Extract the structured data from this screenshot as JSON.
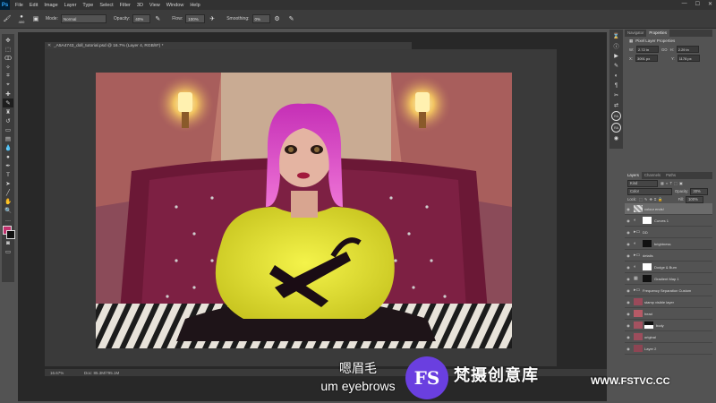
{
  "app": {
    "logo": "Ps"
  },
  "menu": [
    "File",
    "Edit",
    "Image",
    "Layer",
    "Type",
    "Select",
    "Filter",
    "3D",
    "View",
    "Window",
    "Help"
  ],
  "window_controls": [
    "—",
    "☐",
    "✕"
  ],
  "options": {
    "brush_size": "400",
    "mode_label": "Mode:",
    "mode_value": "Normal",
    "opacity_label": "Opacity:",
    "opacity_value": "40%",
    "flow_label": "Flow:",
    "flow_value": "100%",
    "smoothing_label": "Smoothing:",
    "smoothing_value": "0%"
  },
  "document": {
    "tab_title": "_A5A4743_doll_tutorial.psd @ 16.7% (Layer 4, RGB/8*) *",
    "zoom": "16.67%",
    "doc_size": "Doc: 85.3M/795.1M"
  },
  "properties": {
    "tabs": [
      "Navigator",
      "Properties"
    ],
    "title": "Pixel Layer Properties",
    "w_label": "W:",
    "w_value": "2.72 in",
    "go_label": "GO",
    "h_label": "H:",
    "h_value": "2.29 in",
    "x_label": "X:",
    "x_value": "3091 px",
    "y_label": "Y:",
    "y_value": "1178 px"
  },
  "layers_panel": {
    "tabs": [
      "Layers",
      "Channels",
      "Paths"
    ],
    "kind_label": "Kind",
    "blend_mode": "Color",
    "opacity_label": "Opacity:",
    "opacity_value": "30%",
    "lock_label": "Lock:",
    "fill_label": "Fill:",
    "fill_value": "100%",
    "layers": [
      {
        "name": "colour ends!",
        "type": "pixel",
        "selected": true
      },
      {
        "name": "Curves 1",
        "type": "adjust"
      },
      {
        "name": "DD",
        "type": "folder"
      },
      {
        "name": "brightness",
        "type": "adjust"
      },
      {
        "name": "details",
        "type": "folder"
      },
      {
        "name": "Dodge & Burn",
        "type": "adjust"
      },
      {
        "name": "Gradient Map 1",
        "type": "adjust"
      },
      {
        "name": "Frequency Separation Custom",
        "type": "folder"
      },
      {
        "name": "stamp visible layer",
        "type": "pixel"
      },
      {
        "name": "head",
        "type": "pixel"
      },
      {
        "name": "body",
        "type": "pixel"
      },
      {
        "name": "original",
        "type": "pixel"
      },
      {
        "name": "Layer 2",
        "type": "pixel"
      }
    ]
  },
  "subtitle": {
    "cn": "嗯眉毛",
    "en": "um eyebrows"
  },
  "watermark": {
    "badge": "FS",
    "cn": "梵摄创意库",
    "url": "WWW.FSTVC.CC"
  },
  "colors": {
    "foreground": "#c2316e",
    "background": "#111111",
    "wig": "#d44bc4",
    "coat": "#e6e52a"
  }
}
